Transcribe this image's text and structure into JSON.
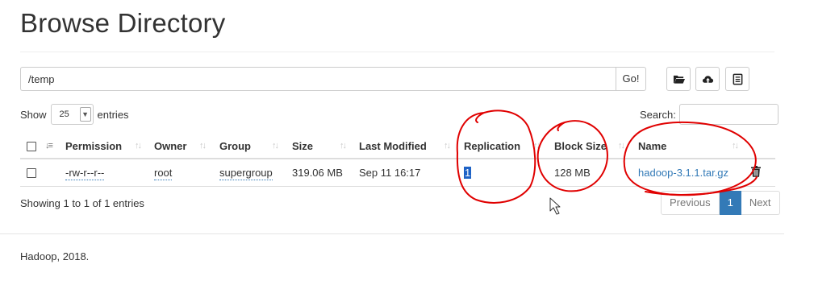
{
  "page": {
    "title": "Browse Directory"
  },
  "path_bar": {
    "value": "/temp",
    "go_label": "Go!"
  },
  "toolbar": {
    "create_dir_icon": "folder-open-icon",
    "upload_icon": "cloud-upload-icon",
    "cut_paste_icon": "list-alt-icon"
  },
  "table_controls": {
    "show_label": "Show",
    "entries_value": "25",
    "entries_label": "entries",
    "search_label": "Search:"
  },
  "table": {
    "headers": [
      "Permission",
      "Owner",
      "Group",
      "Size",
      "Last Modified",
      "Replication",
      "Block Size",
      "Name"
    ],
    "rows": [
      {
        "permission": "-rw-r--r--",
        "owner": "root",
        "group": "supergroup",
        "size": "319.06 MB",
        "last_modified": "Sep 11 16:17",
        "replication": "1",
        "block_size": "128 MB",
        "name": "hadoop-3.1.1.tar.gz"
      }
    ]
  },
  "info": {
    "text": "Showing 1 to 1 of 1 entries"
  },
  "pagination": {
    "previous": "Previous",
    "current": "1",
    "next": "Next"
  },
  "footer": {
    "text": "Hadoop, 2018."
  },
  "colors": {
    "link": "#337ab7",
    "annotation": "#e00000"
  }
}
